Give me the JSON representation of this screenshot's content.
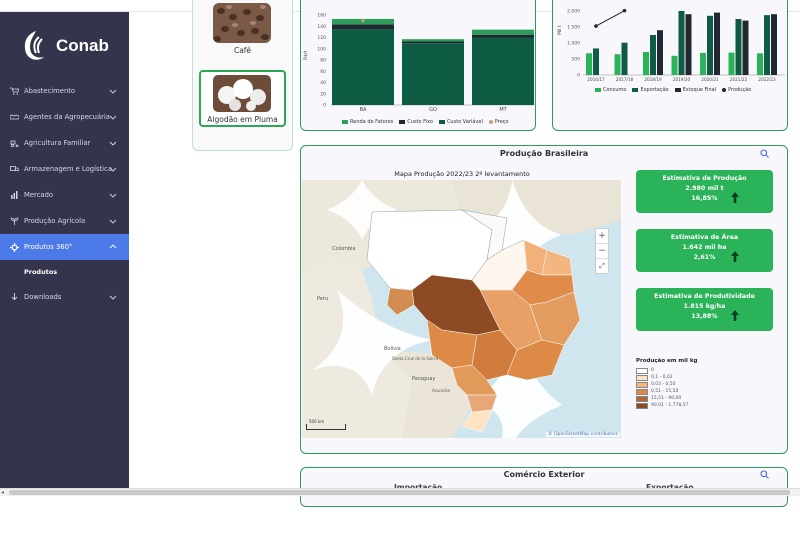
{
  "brand": {
    "name": "Conab"
  },
  "sidebar": {
    "items": [
      {
        "label": "Abastecimento",
        "icon": "cart-icon"
      },
      {
        "label": "Agentes da Agropecuária",
        "icon": "handshake-icon"
      },
      {
        "label": "Agricultura Familiar",
        "icon": "tractor-icon"
      },
      {
        "label": "Armazenagem e Logística",
        "icon": "truck-icon"
      },
      {
        "label": "Mercado",
        "icon": "bar-chart-icon"
      },
      {
        "label": "Produção Agrícola",
        "icon": "seedling-icon"
      },
      {
        "label": "Produtos 360°",
        "icon": "gear-icon"
      }
    ],
    "active_sub": "Produtos",
    "downloads": "Downloads"
  },
  "products": [
    {
      "label": "Café"
    },
    {
      "label": "Algodão em Pluma"
    }
  ],
  "cost_chart": {
    "type": "bar",
    "ylabel": "R$/t",
    "yticks": [
      "160",
      "140",
      "120",
      "100",
      "80",
      "60",
      "40",
      "20",
      "0"
    ],
    "categories": [
      "BA",
      "GO",
      "MT"
    ],
    "series": [
      {
        "name": "Renda de Fatores",
        "color": "#2e9c5a",
        "values": [
          10,
          4,
          9
        ]
      },
      {
        "name": "Custo Fixo",
        "color": "#222831",
        "values": [
          8,
          3,
          5
        ]
      },
      {
        "name": "Custo Variável",
        "color": "#0f5c45",
        "values": [
          135,
          110,
          120
        ]
      },
      {
        "name": "Preço",
        "color": "#c2a477",
        "values": [
          150,
          null,
          null
        ]
      }
    ]
  },
  "balance_chart": {
    "type": "bar",
    "ylabel": "Mil t",
    "yticks": [
      "2.000",
      "1.500",
      "1.000",
      "500",
      "0"
    ],
    "categories": [
      "2016/17",
      "2017/18",
      "2018/19",
      "2019/20",
      "2020/21",
      "2021/22",
      "2022/23"
    ],
    "series": [
      {
        "name": "Consumo",
        "color": "#2bb35a",
        "values": [
          680,
          650,
          720,
          600,
          690,
          700,
          680
        ]
      },
      {
        "name": "Exportação",
        "color": "#0f5c45",
        "values": [
          830,
          1010,
          1250,
          2000,
          1850,
          1750,
          1870
        ]
      },
      {
        "name": "Estoque Final",
        "color": "#222831",
        "values": [
          null,
          null,
          1400,
          1900,
          1950,
          1700,
          1900
        ]
      },
      {
        "name": "Produção",
        "color": "#222222",
        "values": [
          1530,
          2010,
          null,
          null,
          null,
          null,
          null
        ]
      }
    ],
    "xtick_labels": [
      "2016/17",
      "2017/18",
      "2018/19",
      "2019/20",
      "2020/21",
      "2021/22",
      "2022/23"
    ],
    "visible_tick_labels": [
      "2016/17",
      "2017/18",
      "2018/19",
      "2019/20",
      "2020/21",
      "2021/22",
      "2022/23"
    ]
  },
  "producao": {
    "title": "Produção Brasileira",
    "map_title": "Mapa Produção 2022/23 2º levantamento",
    "kpis": [
      {
        "title": "Estimativa de Produção",
        "value": "2.980 mil t",
        "change": "16,85%"
      },
      {
        "title": "Estimativa de Área",
        "value": "1.642 mil ha",
        "change": "2,61%"
      },
      {
        "title": "Estimativa de Produtividade",
        "value": "1.815 kg/ha",
        "change": "13,88%"
      }
    ],
    "legend_title": "Produção em mil kg",
    "legend_items": [
      {
        "label": "0",
        "color": "#ffffff"
      },
      {
        "label": "0,1 - 0,02",
        "color": "#fde2c4"
      },
      {
        "label": "0,03 - 0,50",
        "color": "#f3b681"
      },
      {
        "label": "0,51 - 15,50",
        "color": "#dc8a45"
      },
      {
        "label": "15,51 - 90,00",
        "color": "#b9652f"
      },
      {
        "label": "90,01 - 1.778,57",
        "color": "#8c4b22"
      }
    ],
    "zoom_in": "+",
    "zoom_out": "−",
    "scale_label": "500 km",
    "attribution": "© OpenStreetMap contributors",
    "map_labels": {
      "country1": "Colombia",
      "country2": "Peru",
      "country3": "Bolivia",
      "country4": "Paraguay",
      "city1": "Santa Cruz de la Sierra",
      "city2": "Asunción"
    }
  },
  "comercio": {
    "title": "Comércio Exterior",
    "importacao": "Importação",
    "exportacao": "Exportação"
  }
}
